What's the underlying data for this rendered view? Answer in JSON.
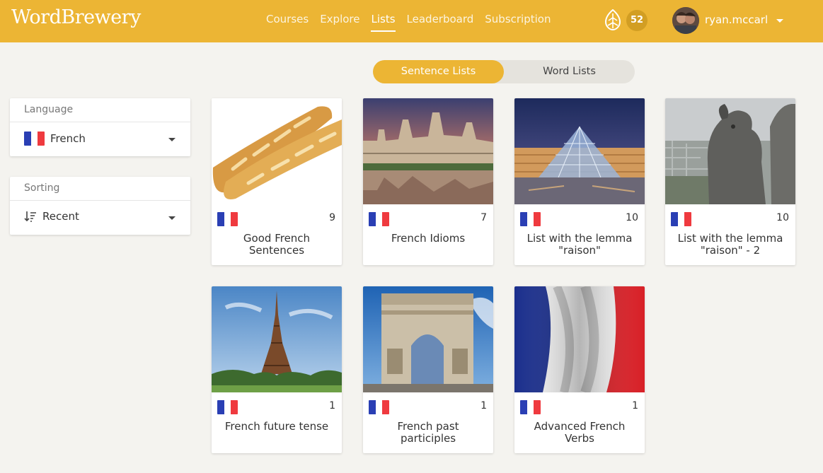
{
  "app": {
    "logo": "WordBrewery"
  },
  "nav": [
    {
      "label": "Courses",
      "active": false
    },
    {
      "label": "Explore",
      "active": false
    },
    {
      "label": "Lists",
      "active": true
    },
    {
      "label": "Leaderboard",
      "active": false
    },
    {
      "label": "Subscription",
      "active": false
    }
  ],
  "header": {
    "points": "52",
    "username": "ryan.mccarl",
    "points_icon": "hops-icon"
  },
  "toggle": {
    "sentence_lists": "Sentence Lists",
    "word_lists": "Word Lists",
    "selected": "Sentence Lists"
  },
  "filters": {
    "language": {
      "label": "Language",
      "value": "French",
      "icon": "french-flag-icon"
    },
    "sorting": {
      "label": "Sorting",
      "value": "Recent",
      "icon": "sort-icon"
    }
  },
  "cards": [
    {
      "title": "Good French Sentences",
      "count": "9",
      "image": "baguettes"
    },
    {
      "title": "French Idioms",
      "count": "7",
      "image": "chateau"
    },
    {
      "title": "List with the lemma \"raison\"",
      "count": "10",
      "image": "louvre-pyramid"
    },
    {
      "title": "List with the lemma \"raison\" - 2",
      "count": "10",
      "image": "gargoyle"
    },
    {
      "title": "French future tense",
      "count": "1",
      "image": "eiffel-tower"
    },
    {
      "title": "French past participles",
      "count": "1",
      "image": "arc-de-triomphe"
    },
    {
      "title": "Advanced French Verbs",
      "count": "1",
      "image": "french-flag"
    }
  ],
  "colors": {
    "accent": "#ecb534",
    "background": "#f4f3ef",
    "flag_blue": "#2a3fb4",
    "flag_red": "#ef3a3f"
  }
}
